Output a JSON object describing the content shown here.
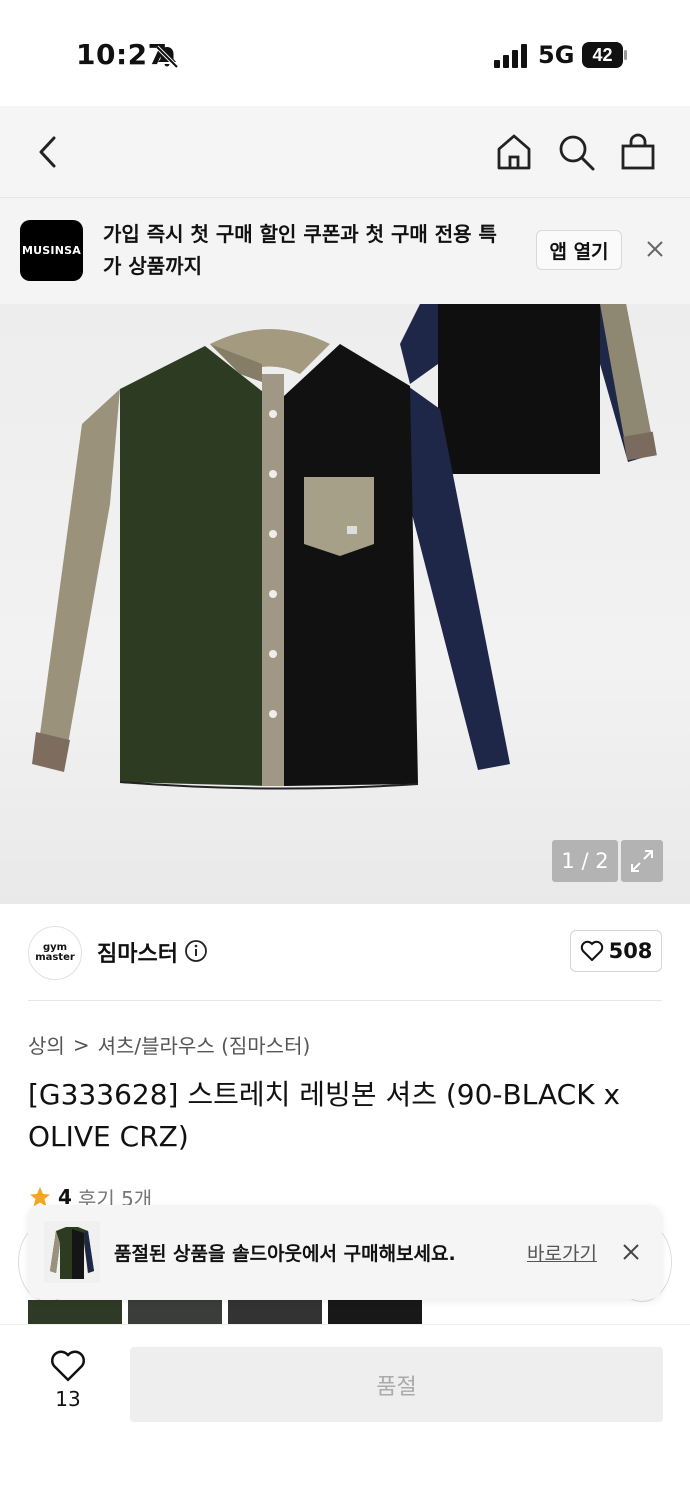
{
  "status_bar": {
    "time": "10:27",
    "network": "5G",
    "battery": "42"
  },
  "nav": {
    "icons": [
      "back-icon",
      "home-icon",
      "search-icon",
      "shopping-bag-icon"
    ]
  },
  "app_banner": {
    "logo_text": "MUSINSA",
    "message": "가입 즉시 첫 구매 할인 쿠폰과 첫 구매 전용 특가 상품까지",
    "open_label": "앱 열기"
  },
  "gallery": {
    "counter": "1 / 2"
  },
  "brand": {
    "logo_line1": "gym",
    "logo_line2": "master",
    "name": "짐마스터",
    "like_count": "508"
  },
  "breadcrumb": {
    "category": "상의",
    "separator": ">",
    "subcategory": "셔츠/블라우스 (짐마스터)"
  },
  "product": {
    "title": "[G333628] 스트레치 레빙본 셔츠 (90-BLACK x OLIVE CRZ)",
    "rating": "4",
    "review_label": "후기 5개"
  },
  "toast": {
    "message": "품절된 상품을 솔드아웃에서 구매해보세요.",
    "link_label": "바로가기"
  },
  "bottom_bar": {
    "wish_count": "13",
    "soldout_label": "품절"
  },
  "colors": {
    "accent_star": "#f5a623",
    "banner_bg": "#f4f4f4",
    "disabled_text": "#aaaaaa"
  }
}
